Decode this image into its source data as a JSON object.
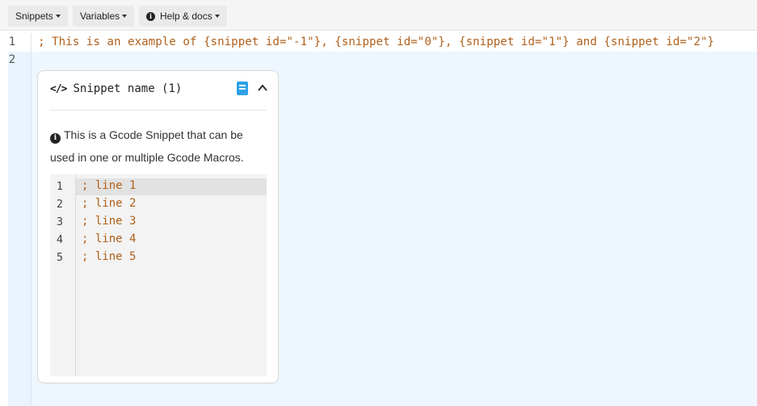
{
  "toolbar": {
    "snippets_label": "Snippets",
    "variables_label": "Variables",
    "help_label": "Help & docs"
  },
  "editor": {
    "line_numbers": [
      "1",
      "2"
    ],
    "line1": "; This is an example of {snippet id=\"-1\"}, {snippet id=\"0\"}, {snippet id=\"1\"} and {snippet id=\"2\"}"
  },
  "widget": {
    "title": "Snippet name (1)",
    "description": "This is a Gcode Snippet that can be used in one or multiple Gcode Macros.",
    "code_lines": [
      {
        "num": "1",
        "text": "; line 1"
      },
      {
        "num": "2",
        "text": "; line 2"
      },
      {
        "num": "3",
        "text": "; line 3"
      },
      {
        "num": "4",
        "text": "; line 4"
      },
      {
        "num": "5",
        "text": "; line 5"
      }
    ]
  },
  "colors": {
    "code_text": "#b0611c",
    "accent_blue": "#2ea1e6",
    "editor_bg": "#eef7ff"
  }
}
